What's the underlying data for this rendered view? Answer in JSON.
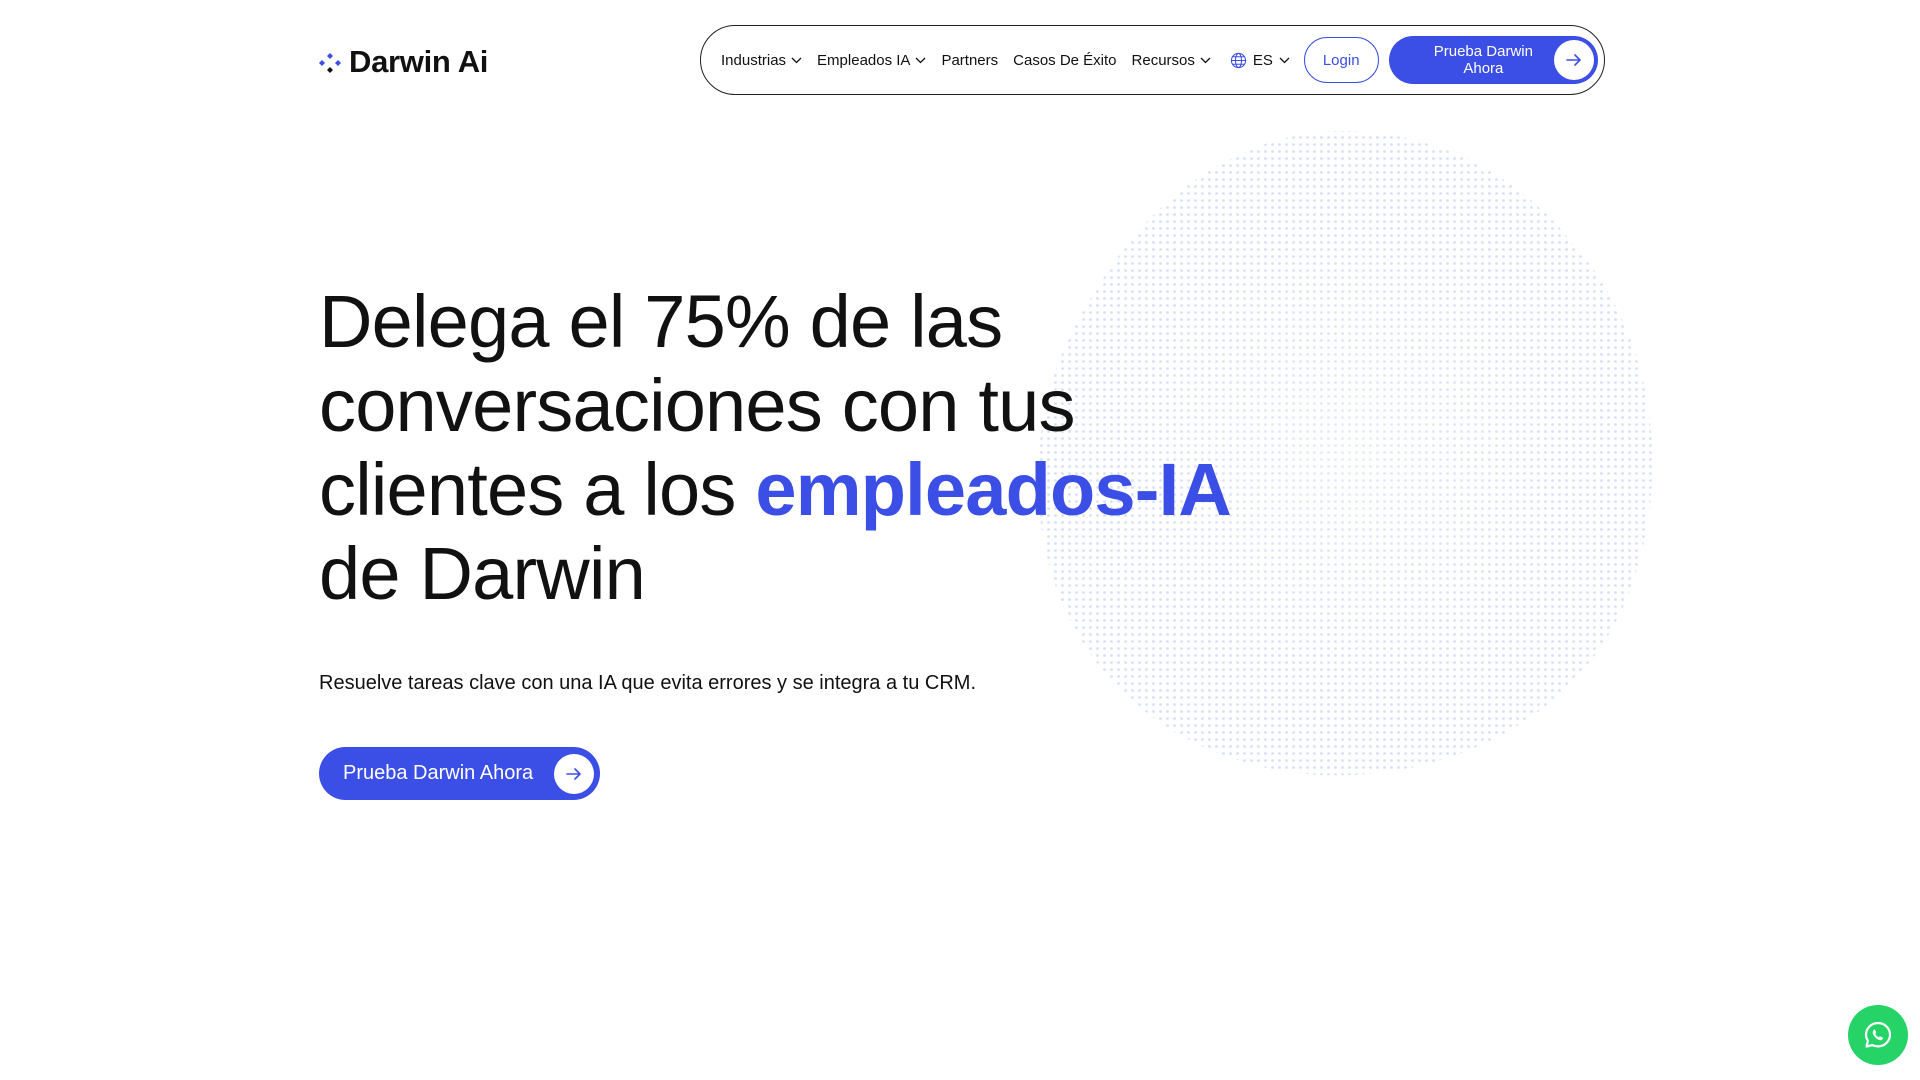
{
  "header": {
    "logo_text": "Darwin Ai",
    "logo_icon": "darwin-logo-icon"
  },
  "nav": {
    "items": [
      {
        "label": "Industrias",
        "has_dropdown": true
      },
      {
        "label": "Empleados IA",
        "has_dropdown": true
      },
      {
        "label": "Partners",
        "has_dropdown": false
      },
      {
        "label": "Casos De Éxito",
        "has_dropdown": false
      },
      {
        "label": "Recursos",
        "has_dropdown": true
      }
    ],
    "language": "ES",
    "language_icon": "globe-icon",
    "login_label": "Login",
    "cta_label": "Prueba Darwin Ahora"
  },
  "hero": {
    "title_part1": "Delega el 75% de las conversaciones con tus clientes a los ",
    "title_accent": "empleados-IA",
    "title_part2": " de Darwin",
    "subtitle": "Resuelve tareas clave con una IA que evita errores y se integra a tu CRM.",
    "cta_label": "Prueba Darwin Ahora"
  },
  "floating": {
    "whatsapp_icon": "whatsapp-icon"
  },
  "colors": {
    "accent": "#3b4ee6",
    "text": "#111111",
    "whatsapp": "#25d366",
    "background": "#ffffff"
  }
}
